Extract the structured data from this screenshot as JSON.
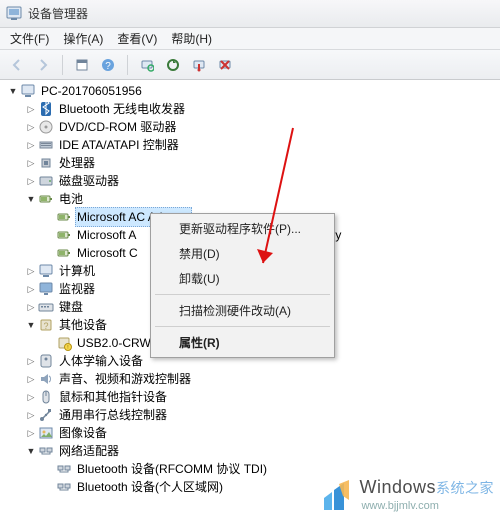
{
  "window": {
    "title": "设备管理器"
  },
  "menu": {
    "file": "文件(F)",
    "action": "操作(A)",
    "view": "查看(V)",
    "help": "帮助(H)"
  },
  "toolbar_icons": {
    "back": "back-arrow",
    "fwd": "forward-arrow",
    "props": "properties",
    "help": "help",
    "scan": "scan-hardware",
    "update": "update-driver",
    "disable": "disable",
    "uninstall": "uninstall"
  },
  "tree": {
    "root": "PC-201706051956",
    "items": [
      {
        "label": "Bluetooth 无线电收发器",
        "icon": "bluetooth",
        "expandable": true
      },
      {
        "label": "DVD/CD-ROM 驱动器",
        "icon": "disc",
        "expandable": true
      },
      {
        "label": "IDE ATA/ATAPI 控制器",
        "icon": "ide",
        "expandable": true
      },
      {
        "label": "处理器",
        "icon": "cpu",
        "expandable": true
      },
      {
        "label": "磁盘驱动器",
        "icon": "disk",
        "expandable": true
      },
      {
        "label": "电池",
        "icon": "battery",
        "expandable": true,
        "expanded": true,
        "children": [
          {
            "label": "Microsoft AC Adapter",
            "icon": "battery",
            "selected": true
          },
          {
            "label": "Microsoft A",
            "icon": "battery",
            "partial_tail": "tery"
          },
          {
            "label": "Microsoft C",
            "icon": "battery"
          }
        ]
      },
      {
        "label": "计算机",
        "icon": "computer",
        "expandable": true
      },
      {
        "label": "监视器",
        "icon": "monitor",
        "expandable": true
      },
      {
        "label": "键盘",
        "icon": "keyboard",
        "expandable": true
      },
      {
        "label": "其他设备",
        "icon": "other",
        "expandable": true,
        "expanded": true,
        "children": [
          {
            "label": "USB2.0-CRW",
            "icon": "unknown"
          }
        ]
      },
      {
        "label": "人体学输入设备",
        "icon": "hid",
        "expandable": true
      },
      {
        "label": "声音、视频和游戏控制器",
        "icon": "sound",
        "expandable": true
      },
      {
        "label": "鼠标和其他指针设备",
        "icon": "mouse",
        "expandable": true
      },
      {
        "label": "通用串行总线控制器",
        "icon": "usb",
        "expandable": true
      },
      {
        "label": "图像设备",
        "icon": "image",
        "expandable": true
      },
      {
        "label": "网络适配器",
        "icon": "network",
        "expandable": true,
        "expanded": true,
        "children": [
          {
            "label": "Bluetooth 设备(RFCOMM 协议 TDI)",
            "icon": "network"
          },
          {
            "label": "Bluetooth 设备(个人区域网)",
            "icon": "network"
          }
        ]
      }
    ]
  },
  "context_menu": {
    "update": "更新驱动程序软件(P)...",
    "disable": "禁用(D)",
    "uninstall": "卸载(U)",
    "scan": "扫描检测硬件改动(A)",
    "props": "属性(R)"
  },
  "watermark": {
    "brand1": "Windows",
    "brand2": "系统之家",
    "url": "www.bjjmlv.com"
  },
  "bottom_truncated": ""
}
